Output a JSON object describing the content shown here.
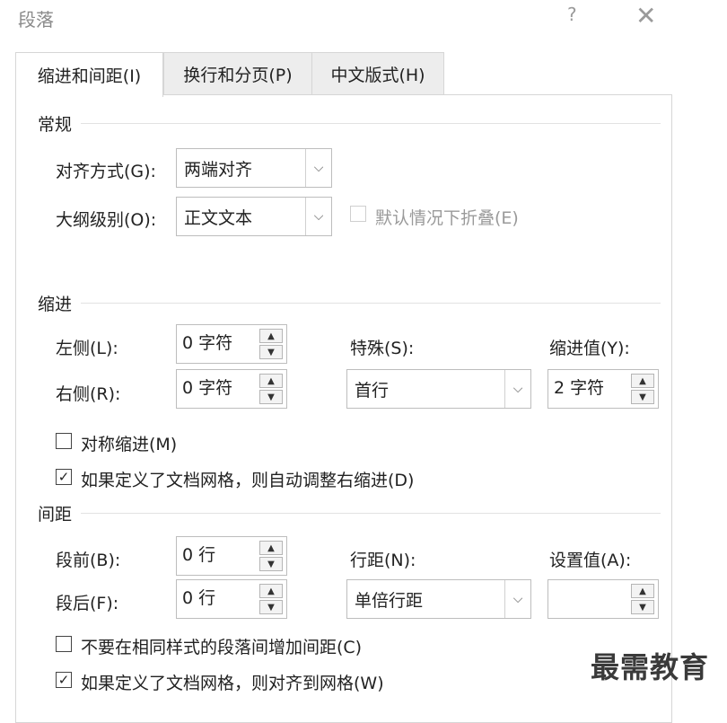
{
  "dialog": {
    "title": "段落",
    "help": "?",
    "close": "✕"
  },
  "tabs": [
    {
      "label": "缩进和间距(I)"
    },
    {
      "label": "换行和分页(P)"
    },
    {
      "label": "中文版式(H)"
    }
  ],
  "general": {
    "heading": "常规",
    "alignment_label": "对齐方式(G):",
    "alignment_value": "两端对齐",
    "outline_label": "大纲级别(O):",
    "outline_value": "正文文本",
    "collapse_label": "默认情况下折叠(E)"
  },
  "indent": {
    "heading": "缩进",
    "left_label": "左侧(L):",
    "left_value": "0 字符",
    "right_label": "右侧(R):",
    "right_value": "0 字符",
    "special_label": "特殊(S):",
    "special_value": "首行",
    "by_label": "缩进值(Y):",
    "by_value": "2 字符",
    "mirror_label": "对称缩进(M)",
    "auto_adjust_label": "如果定义了文档网格，则自动调整右缩进(D)"
  },
  "spacing": {
    "heading": "间距",
    "before_label": "段前(B):",
    "before_value": "0 行",
    "after_label": "段后(F):",
    "after_value": "0 行",
    "line_label": "行距(N):",
    "line_value": "单倍行距",
    "at_label": "设置值(A):",
    "at_value": "",
    "no_space_label": "不要在相同样式的段落间增加间距(C)",
    "snap_grid_label": "如果定义了文档网格，则对齐到网格(W)"
  },
  "checkbox_states": {
    "collapse": false,
    "mirror": false,
    "auto_adjust": true,
    "no_space": false,
    "snap_grid": true
  },
  "watermark": "最需教育"
}
